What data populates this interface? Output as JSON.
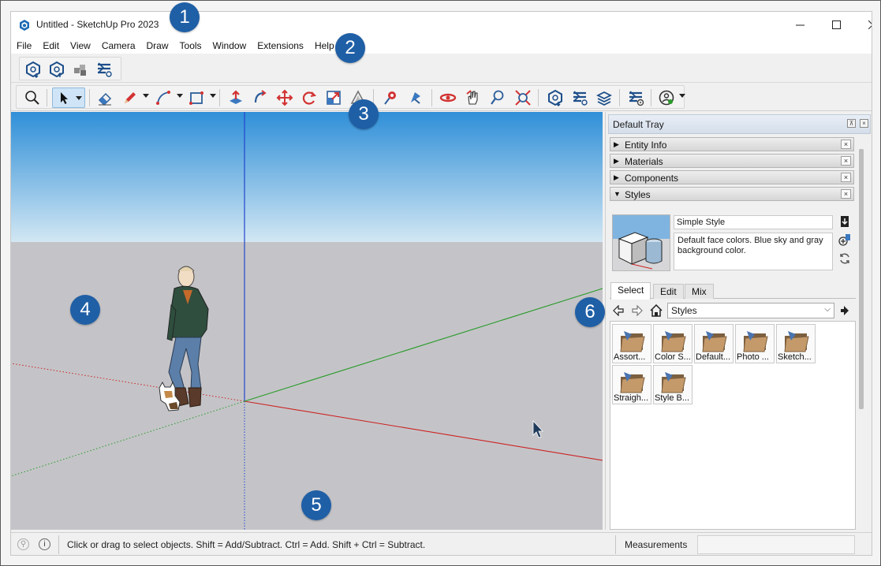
{
  "window": {
    "title": "Untitled - SketchUp Pro 2023",
    "min_icon": "minimize-icon",
    "max_icon": "maximize-icon",
    "close_icon": "close-icon"
  },
  "menu": [
    "File",
    "Edit",
    "View",
    "Camera",
    "Draw",
    "Tools",
    "Window",
    "Extensions",
    "Help"
  ],
  "toolbar_top": {
    "icons": [
      "warehouse-download-icon",
      "warehouse-share-icon",
      "extension-warehouse-icon",
      "layout-send-icon"
    ]
  },
  "toolbar_main": {
    "icons": [
      "search-icon",
      "select-icon",
      "eraser-icon",
      "pencil-icon",
      "arc-icon",
      "rectangle-icon",
      "push-pull-icon",
      "follow-me-icon",
      "move-icon",
      "rotate-icon",
      "scale-icon",
      "offset-icon",
      "paint-bucket-icon",
      "tape-measure-icon",
      "orbit-icon",
      "pan-icon",
      "zoom-icon",
      "zoom-extents-icon",
      "warehouse-icon",
      "layout-icon",
      "extension-icon",
      "extension-manager-icon",
      "user-account-icon"
    ]
  },
  "tray": {
    "title": "Default Tray",
    "panels": [
      {
        "label": "Entity Info",
        "expanded": false
      },
      {
        "label": "Materials",
        "expanded": false
      },
      {
        "label": "Components",
        "expanded": false
      },
      {
        "label": "Styles",
        "expanded": true
      }
    ],
    "close_glyph": "×",
    "styles": {
      "name": "Simple Style",
      "description": "Default face colors. Blue sky and gray background color.",
      "tabs": [
        "Select",
        "Edit",
        "Mix"
      ],
      "active_tab": "Select",
      "dropdown_value": "Styles",
      "dropdown_arrow": "⌵",
      "library": [
        "Assort...",
        "Color S...",
        "Default...",
        "Photo ...",
        "Sketch...",
        "Straigh...",
        "Style B..."
      ]
    }
  },
  "status": {
    "text": "Click or drag to select objects. Shift = Add/Subtract. Ctrl = Add. Shift + Ctrl = Subtract.",
    "measurements_label": "Measurements",
    "measurements_value": ""
  },
  "callouts": [
    "1",
    "2",
    "3",
    "4",
    "5",
    "6"
  ],
  "colors": {
    "sky_top": "#2f8fd8",
    "sky_bottom": "#d2e7f3",
    "ground": "#c4c4c8",
    "axis_red": "#cc2222",
    "axis_green": "#2a9a2a",
    "axis_blue": "#2244cc",
    "callout": "#1f5fa6"
  }
}
